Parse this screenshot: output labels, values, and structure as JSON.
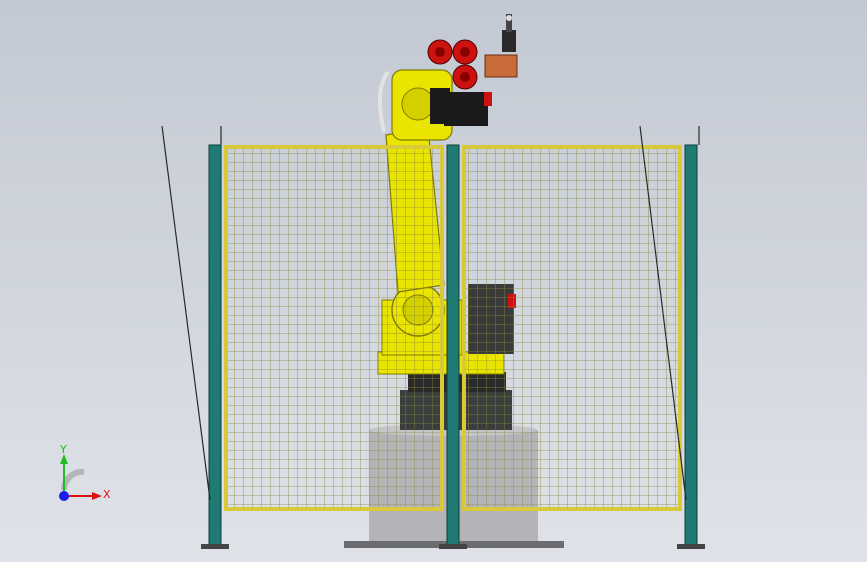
{
  "viewport": {
    "background_top": "#c3c9d3",
    "background_bottom": "#dfe3e9"
  },
  "colors": {
    "fence_post": "#1e7a72",
    "fence_frame": "#d8c93a",
    "mesh": "#8c8a3a",
    "robot_yellow": "#e9e400",
    "robot_shadow": "#a8a400",
    "motor_red": "#cc1111",
    "motor_black": "#1a1a1a",
    "gripper_orange": "#c86a3a",
    "pedestal": "#b4b4b8",
    "axis_x": "#e01010",
    "axis_y": "#22bb22",
    "axis_z": "#1a1aee"
  },
  "triad": {
    "y_label": "Y",
    "x_label": "X",
    "icon": "coordinate-triad-icon"
  }
}
